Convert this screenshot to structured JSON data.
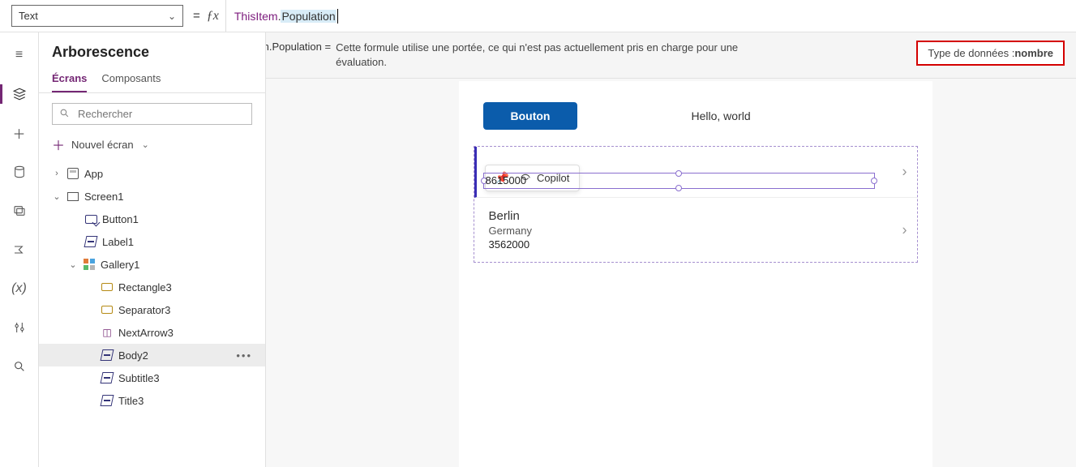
{
  "property_dropdown": {
    "label": "Text"
  },
  "formula": {
    "obj": "ThisItem",
    "prop": "Population"
  },
  "result": {
    "lhs": "ThisItem.Population  =",
    "message": "Cette formule utilise une portée, ce qui n'est pas actuellement pris en charge pour une évaluation."
  },
  "datatype": {
    "prefix": "Type de données :",
    "value": "nombre"
  },
  "tree": {
    "title": "Arborescence",
    "tabs": {
      "screens": "Écrans",
      "components": "Composants"
    },
    "search_placeholder": "Rechercher",
    "new_screen": "Nouvel écran",
    "nodes": {
      "app": "App",
      "screen1": "Screen1",
      "button1": "Button1",
      "label1": "Label1",
      "gallery1": "Gallery1",
      "rectangle3": "Rectangle3",
      "separator3": "Separator3",
      "nextarrow3": "NextArrow3",
      "body2": "Body2",
      "subtitle3": "Subtitle3",
      "title3": "Title3"
    }
  },
  "canvas": {
    "button_label": "Bouton",
    "hello": "Hello, world",
    "copilot": {
      "label": "Copilot"
    },
    "items": [
      {
        "city": "",
        "country": "",
        "population": "8615000"
      },
      {
        "city": "Berlin",
        "country": "Germany",
        "population": "3562000"
      }
    ]
  }
}
